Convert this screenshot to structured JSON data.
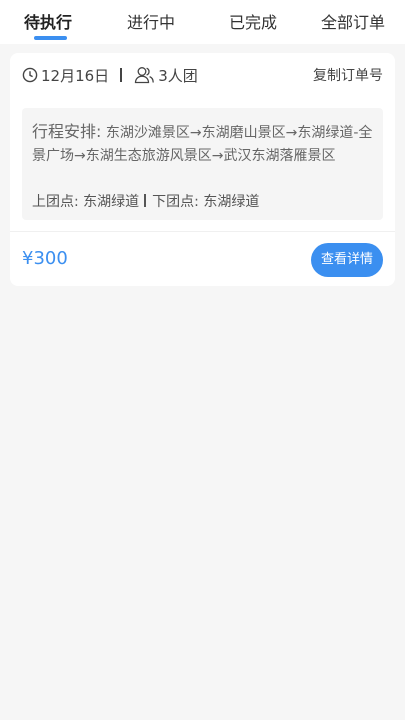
{
  "tabs": [
    {
      "label": "待执行"
    },
    {
      "label": "进行中"
    },
    {
      "label": "已完成"
    },
    {
      "label": "全部订单"
    }
  ],
  "order": {
    "date": "12月16日",
    "group": "3人团",
    "copy_label": "复制订单号",
    "route_label": "行程安排:",
    "route": "东湖沙滩景区→东湖磨山景区→东湖绿道-全景广场→东湖生态旅游风景区→武汉东湖落雁景区",
    "pickup_label": "上团点:",
    "pickup": "东湖绿道",
    "dropoff_label": "下团点:",
    "dropoff": "东湖绿道",
    "price": "¥300",
    "detail_label": "查看详情"
  },
  "icons": {
    "date": "clock-icon",
    "group": "people-icon"
  },
  "colors": {
    "accent": "#3b8ff0",
    "background": "#f6f6f6"
  }
}
